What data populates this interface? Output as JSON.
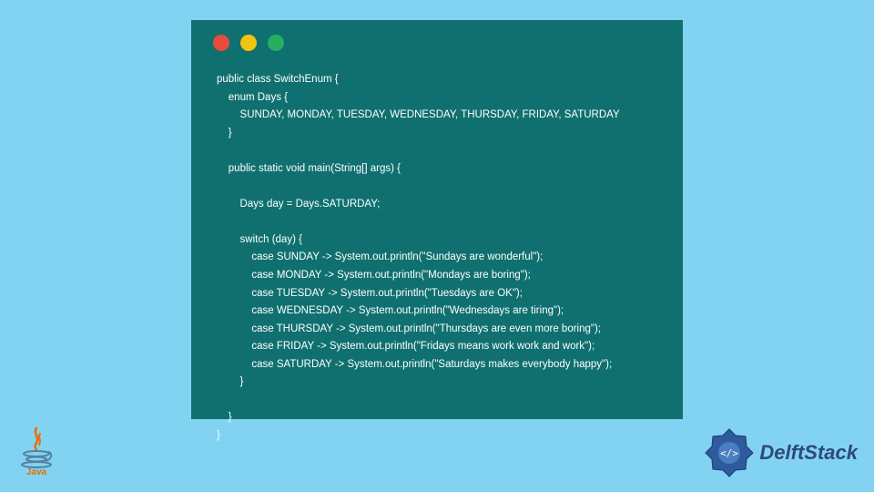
{
  "window": {
    "dots": [
      "red",
      "yellow",
      "green"
    ]
  },
  "code": {
    "lines": [
      "public class SwitchEnum {",
      "    enum Days {",
      "        SUNDAY, MONDAY, TUESDAY, WEDNESDAY, THURSDAY, FRIDAY, SATURDAY",
      "    }",
      "",
      "    public static void main(String[] args) {",
      "",
      "        Days day = Days.SATURDAY;",
      "",
      "        switch (day) {",
      "            case SUNDAY -> System.out.println(\"Sundays are wonderful\");",
      "            case MONDAY -> System.out.println(\"Mondays are boring\");",
      "            case TUESDAY -> System.out.println(\"Tuesdays are OK\");",
      "            case WEDNESDAY -> System.out.println(\"Wednesdays are tiring\");",
      "            case THURSDAY -> System.out.println(\"Thursdays are even more boring\");",
      "            case FRIDAY -> System.out.println(\"Fridays means work work and work\");",
      "            case SATURDAY -> System.out.println(\"Saturdays makes everybody happy\");",
      "        }",
      "",
      "    }",
      "}"
    ]
  },
  "logos": {
    "java": "Java",
    "delft": "DelftStack"
  }
}
